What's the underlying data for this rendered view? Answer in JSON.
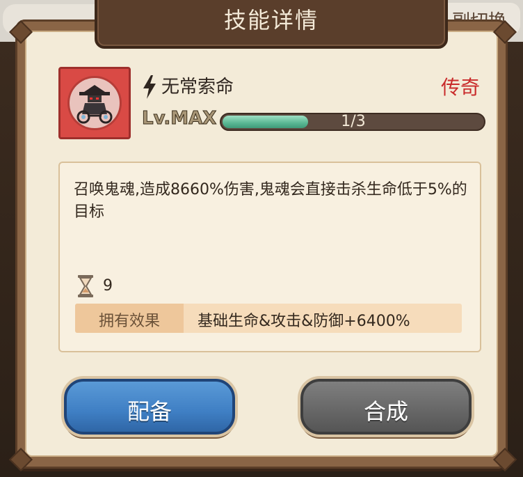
{
  "background": {
    "top_right_text": "副切换"
  },
  "dialog": {
    "title": "技能详情"
  },
  "skill": {
    "name": "无常索命",
    "rarity": "传奇",
    "level_label": "Lv.MAX",
    "progress_text": "1/3",
    "progress_fraction": 0.33,
    "description": "召唤鬼魂,造成8660%伤害,鬼魂会直接击杀生命低于5%的目标",
    "hourglass_count": "9",
    "effect_label": "拥有效果",
    "effect_value": "基础生命&攻击&防御+6400%"
  },
  "buttons": {
    "equip_label": "配备",
    "merge_label": "合成"
  },
  "colors": {
    "rarity": "#c92b2b",
    "equip_button": "#3f7fc4",
    "merge_button": "#666666",
    "progress_fill": "#59b793",
    "panel_bg": "#f3ebd8"
  },
  "icons": {
    "skill_icon": "ghost-rider-icon",
    "type_icon": "lightning-icon",
    "cost_icon": "hourglass-icon"
  }
}
